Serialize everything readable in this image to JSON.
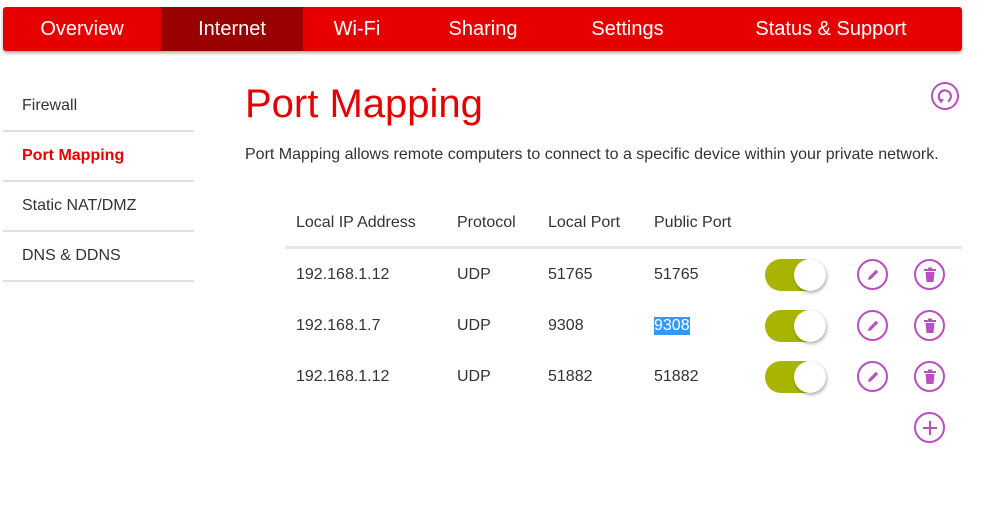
{
  "nav": {
    "tabs": [
      {
        "label": "Overview",
        "active": false
      },
      {
        "label": "Internet",
        "active": true
      },
      {
        "label": "Wi-Fi",
        "active": false
      },
      {
        "label": "Sharing",
        "active": false
      },
      {
        "label": "Settings",
        "active": false
      },
      {
        "label": "Status & Support",
        "active": false
      }
    ]
  },
  "sidebar": {
    "items": [
      {
        "label": "Firewall",
        "active": false
      },
      {
        "label": "Port Mapping",
        "active": true
      },
      {
        "label": "Static NAT/DMZ",
        "active": false
      },
      {
        "label": "DNS & DDNS",
        "active": false
      }
    ]
  },
  "page": {
    "title": "Port Mapping",
    "description": "Port Mapping allows remote computers to connect to a specific device within your private network.",
    "refresh_icon": "refresh-icon"
  },
  "table": {
    "headers": [
      "Local IP Address",
      "Protocol",
      "Local Port",
      "Public Port"
    ],
    "rows": [
      {
        "ip": "192.168.1.12",
        "protocol": "UDP",
        "local_port": "51765",
        "public_port": "51765",
        "enabled": true
      },
      {
        "ip": "192.168.1.7",
        "protocol": "UDP",
        "local_port": "9308",
        "public_port": "9308",
        "enabled": true,
        "public_port_selected": true
      },
      {
        "ip": "192.168.1.12",
        "protocol": "UDP",
        "local_port": "51882",
        "public_port": "51882",
        "enabled": true
      }
    ],
    "add_icon": "plus-icon"
  },
  "colors": {
    "brand_red": "#e60000",
    "active_tab": "#990000",
    "toggle_on": "#a8b400",
    "icon_accent": "#b94fc0",
    "selection": "#3399ff"
  }
}
